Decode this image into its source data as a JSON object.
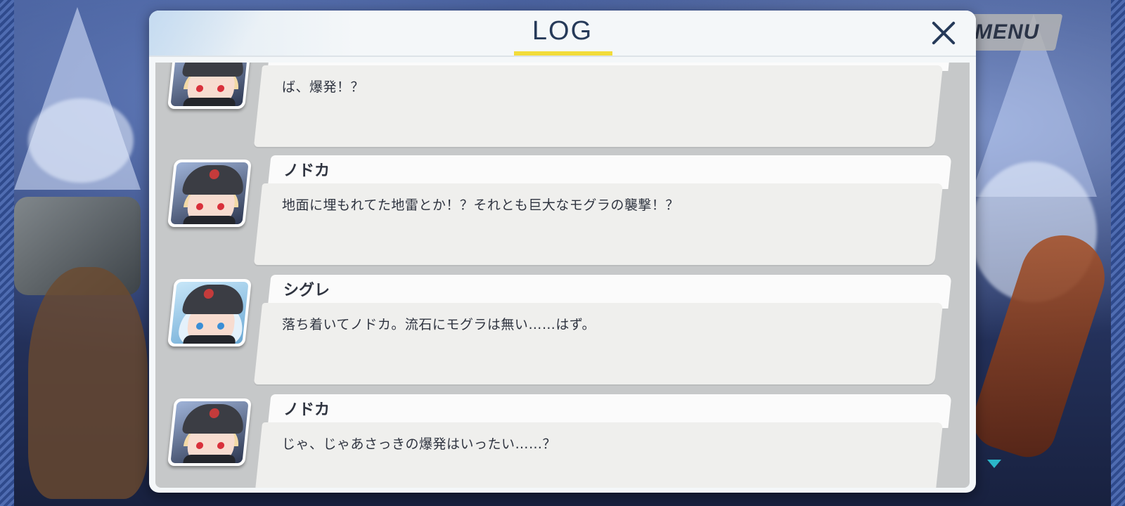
{
  "menu": {
    "label": "MENU"
  },
  "log": {
    "title": "LOG",
    "entries": [
      {
        "speaker": "",
        "text": "ば、爆発！？",
        "portrait": "nodoka-portrait"
      },
      {
        "speaker": "ノドカ",
        "text": "地面に埋もれてた地雷とか！？それとも巨大なモグラの襲撃！？",
        "portrait": "nodoka-portrait"
      },
      {
        "speaker": "シグレ",
        "text": "落ち着いてノドカ。流石にモグラは無い……はず。",
        "portrait": "shigure-portrait"
      },
      {
        "speaker": "ノドカ",
        "text": "じゃ、じゃあさっきの爆発はいったい……？",
        "portrait": "nodoka-portrait"
      }
    ]
  },
  "icons": {
    "close": "close-icon",
    "next": "next-indicator-icon"
  },
  "colors": {
    "title_underline": "#f2dc3a",
    "title_text": "#263a59",
    "panel_bg": "#f4f7f9",
    "next_indicator": "#2bb7c9"
  }
}
